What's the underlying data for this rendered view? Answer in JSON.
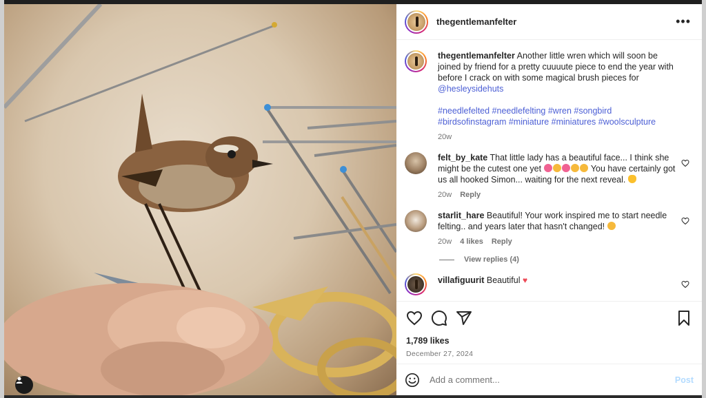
{
  "post": {
    "username": "thegentlemanfelter",
    "more_label": "•••"
  },
  "caption": {
    "username": "thegentlemanfelter",
    "text": "Another little wren which will soon be joined by friend for a pretty cuuuute piece to end the year with before I crack on with some magical brush pieces for",
    "mention": "@hesleysidehuts",
    "hashtags": "#needlefelted #needlefelting #wren #songbird #birdsofinstagram #miniature #miniatures #woolsculpture",
    "time": "20w"
  },
  "comments": [
    {
      "username": "felt_by_kate",
      "text_a": "That little lady has a beautiful face... I think she might be the cutest one yet",
      "text_b": "You have certainly got us all hooked Simon... waiting for the next reveal.",
      "time": "20w",
      "reply_label": "Reply"
    },
    {
      "username": "starlit_hare",
      "text": "Beautiful! Your work inspired me to start needle felting.. and years later that hasn't changed!",
      "time": "20w",
      "likes": "4 likes",
      "reply_label": "Reply",
      "view_replies": "View replies (4)"
    },
    {
      "username": "villafiguurit",
      "text": "Beautiful"
    }
  ],
  "stats": {
    "likes": "1,789 likes",
    "date": "December 27, 2024"
  },
  "composer": {
    "placeholder": "Add a comment...",
    "post_label": "Post"
  },
  "colors": {
    "link": "#4c5fd5",
    "post_disabled": "#b3dbff",
    "heart_red": "#ed4956"
  }
}
